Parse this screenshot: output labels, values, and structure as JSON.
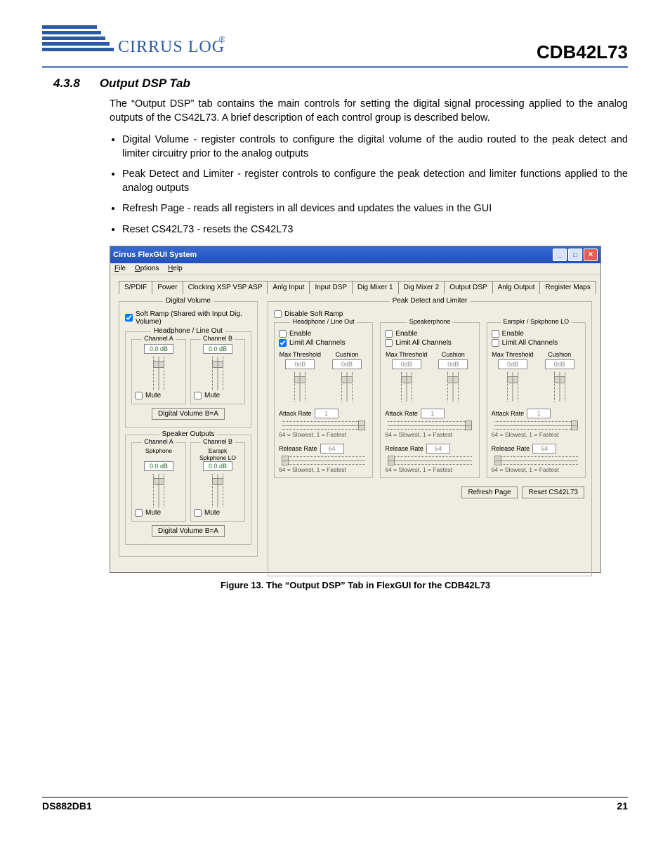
{
  "header": {
    "company": "CIRRUS LOGIC",
    "product": "CDB42L73"
  },
  "section": {
    "number": "4.3.8",
    "title": "Output DSP Tab"
  },
  "paragraph": "The “Output DSP” tab contains the main controls for setting the digital signal processing applied to the analog outputs of the CS42L73. A brief description of each control group is described below.",
  "bullets": [
    "Digital Volume - register controls to configure the digital volume of the audio routed to the peak detect and limiter circuitry prior to the analog outputs",
    "Peak Detect and Limiter - register controls to configure the peak detection and limiter functions applied to the analog outputs",
    "Refresh Page - reads all registers in all devices and updates the values in the GUI",
    "Reset CS42L73 - resets the CS42L73"
  ],
  "window": {
    "title": "Cirrus FlexGUI System",
    "menu": [
      "File",
      "Options",
      "Help"
    ],
    "tabs": [
      "S/PDIF",
      "Power",
      "Clocking XSP VSP ASP",
      "Anlg Input",
      "Input DSP",
      "Dig Mixer 1",
      "Dig Mixer 2",
      "Output DSP",
      "Anlg Output",
      "Register Maps"
    ],
    "active_tab": "Output DSP",
    "dv": {
      "title": "Digital Volume",
      "soft_ramp": "Soft Ramp (Shared with Input Dig. Volume)",
      "hp": {
        "title": "Headphone / Line Out",
        "a": {
          "title": "Channel A",
          "val": "0.0 dB",
          "mute": "Mute"
        },
        "b": {
          "title": "Channel B",
          "val": "0.0 dB",
          "mute": "Mute"
        },
        "btn": "Digital Volume B=A"
      },
      "spk": {
        "title": "Speaker Outputs",
        "a": {
          "title": "Channel A",
          "sub": "Spkphone",
          "sub2": "",
          "val": "0.0 dB",
          "mute": "Mute"
        },
        "b": {
          "title": "Channel B",
          "sub": "Earspk",
          "sub2": "Spkphone LO",
          "val": "0.0 dB",
          "mute": "Mute"
        },
        "btn": "Digital Volume B=A"
      }
    },
    "pd": {
      "title": "Peak Detect and Limiter",
      "disable_soft_ramp": "Disable Soft Ramp",
      "blocks": [
        {
          "title": "Headphone / Line Out",
          "enable": "Enable",
          "limit": "Limit All Channels",
          "limit_checked": true
        },
        {
          "title": "Speakerphone",
          "enable": "Enable",
          "limit": "Limit All Channels",
          "limit_checked": false
        },
        {
          "title": "Earspkr / Spkphone LO",
          "enable": "Enable",
          "limit": "Limit All Channels",
          "limit_checked": false
        }
      ],
      "max_label": "Max Threshold",
      "cushion_label": "Cushion",
      "zero": "0dB",
      "attack_label": "Attack Rate",
      "attack_val": "1",
      "release_label": "Release Rate",
      "release_val": "64",
      "hint": "64 = Slowest, 1 = Fastest"
    },
    "refresh": "Refresh Page",
    "reset": "Reset CS42L73"
  },
  "figure_caption": "Figure 13.  The “Output DSP” Tab in FlexGUI for the CDB42L73",
  "footer": {
    "left": "DS882DB1",
    "right": "21"
  }
}
